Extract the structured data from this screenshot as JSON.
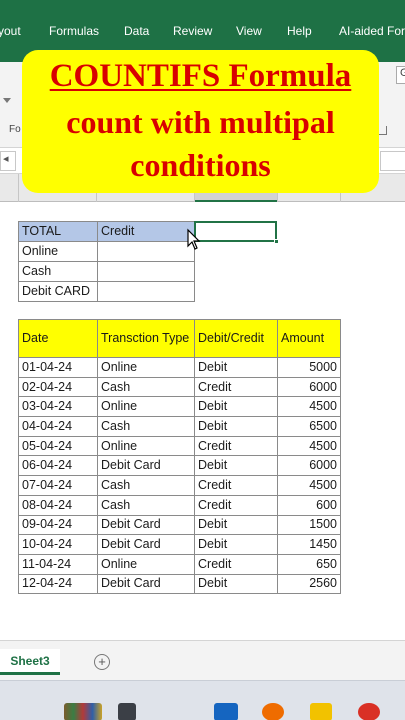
{
  "ribbon": {
    "tabs": [
      "yout",
      "Formulas",
      "Data",
      "Review",
      "View",
      "Help",
      "AI-aided For"
    ]
  },
  "ribbon_fragments": {
    "fo": "Fo",
    "g": "G"
  },
  "overlay": {
    "line1": "COUNTIFS Formula",
    "line2": "count with multipal",
    "line3": "conditions"
  },
  "summary": {
    "header": [
      "TOTAL",
      "Credit"
    ],
    "rows": [
      [
        "Online",
        ""
      ],
      [
        "Cash",
        ""
      ],
      [
        "Debit CARD",
        ""
      ]
    ]
  },
  "transactions": {
    "columns": [
      "Date",
      "Transction Type",
      "Debit/Credit",
      "Amount"
    ],
    "rows": [
      [
        "01-04-24",
        "Online",
        "Debit",
        "5000"
      ],
      [
        "02-04-24",
        "Cash",
        "Credit",
        "6000"
      ],
      [
        "03-04-24",
        "Online",
        "Debit",
        "4500"
      ],
      [
        "04-04-24",
        "Cash",
        "Debit",
        "6500"
      ],
      [
        "05-04-24",
        "Online",
        "Credit",
        "4500"
      ],
      [
        "06-04-24",
        "Debit Card",
        "Debit",
        "6000"
      ],
      [
        "07-04-24",
        "Cash",
        "Credit",
        "4500"
      ],
      [
        "08-04-24",
        "Cash",
        "Credit",
        "600"
      ],
      [
        "09-04-24",
        "Debit Card",
        "Debit",
        "1500"
      ],
      [
        "10-04-24",
        "Debit Card",
        "Debit",
        "1450"
      ],
      [
        "11-04-24",
        "Online",
        "Credit",
        "650"
      ],
      [
        "12-04-24",
        "Debit Card",
        "Debit",
        "2560"
      ]
    ]
  },
  "sheet_tabs": [
    "Sheet3"
  ],
  "colors": {
    "ribbon": "#1e7145",
    "overlay_bg": "#ffff00",
    "overlay_text": "#d80000",
    "summary_header": "#b4c7e7",
    "table_header": "#ffff00"
  }
}
